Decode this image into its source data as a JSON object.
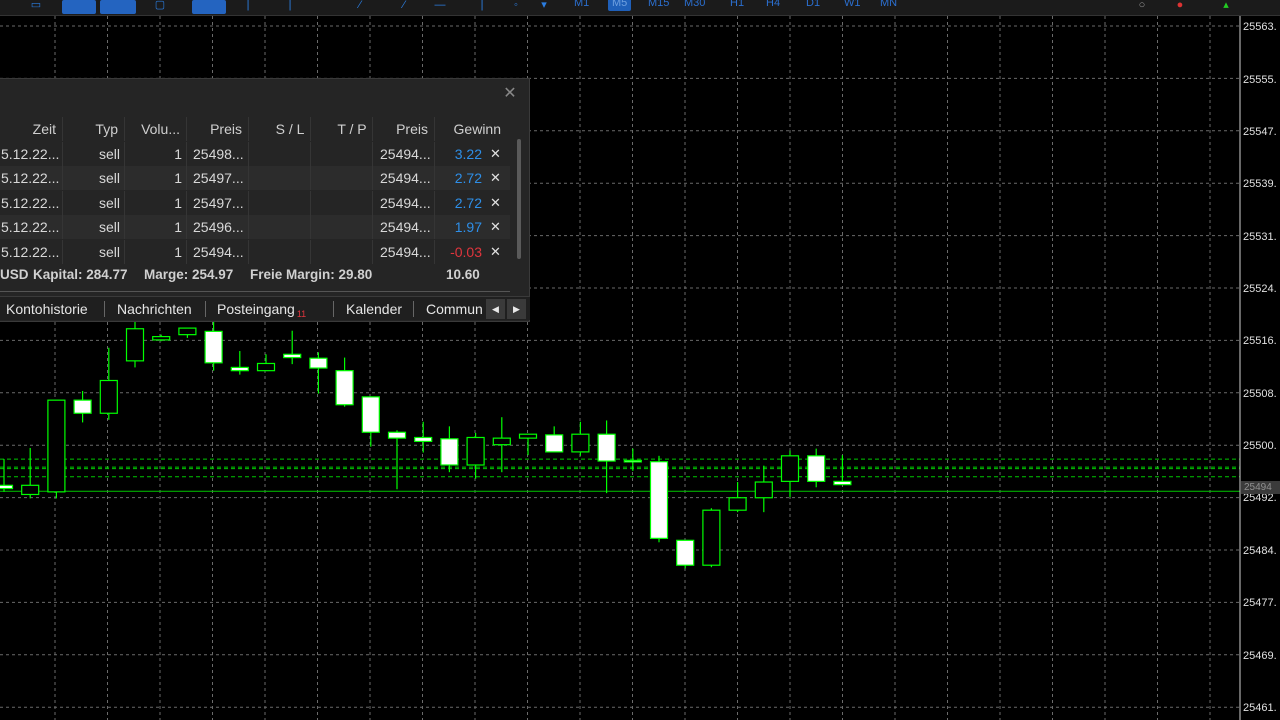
{
  "toolbar": {
    "timeframes": [
      "M1",
      "M5",
      "M15",
      "M30",
      "H1",
      "H4",
      "D1",
      "W1",
      "MN"
    ],
    "active_timeframe": "M5"
  },
  "trade_panel": {
    "columns": [
      "Zeit",
      "Typ",
      "Volu...",
      "Preis",
      "S / L",
      "T / P",
      "Preis",
      "Gewinn"
    ],
    "rows": [
      {
        "time": "5.12.22...",
        "type": "sell",
        "volume": "1",
        "open_price": "25498...",
        "sl": "",
        "tp": "",
        "price": "25494...",
        "profit": "3.22"
      },
      {
        "time": "5.12.22...",
        "type": "sell",
        "volume": "1",
        "open_price": "25497...",
        "sl": "",
        "tp": "",
        "price": "25494...",
        "profit": "2.72"
      },
      {
        "time": "5.12.22...",
        "type": "sell",
        "volume": "1",
        "open_price": "25497...",
        "sl": "",
        "tp": "",
        "price": "25494...",
        "profit": "2.72"
      },
      {
        "time": "5.12.22...",
        "type": "sell",
        "volume": "1",
        "open_price": "25496...",
        "sl": "",
        "tp": "",
        "price": "25494...",
        "profit": "1.97"
      },
      {
        "time": "5.12.22...",
        "type": "sell",
        "volume": "1",
        "open_price": "25494...",
        "sl": "",
        "tp": "",
        "price": "25494...",
        "profit": "-0.03"
      }
    ],
    "summary": {
      "currency": "USD",
      "kapital": "Kapital: 284.77",
      "marge": "Marge: 254.97",
      "freie_margin": "Freie Margin: 29.80",
      "total": "10.60"
    },
    "close_symbol": "✕",
    "row_close_symbol": "✕"
  },
  "tabs": [
    {
      "label": "Kontohistorie"
    },
    {
      "label": "Nachrichten"
    },
    {
      "label": "Posteingang",
      "badge": "11"
    },
    {
      "label": "Kalender"
    },
    {
      "label": "Commun"
    }
  ],
  "tab_nav": {
    "left": "◀",
    "right": "▶"
  },
  "price_axis": {
    "labels": [
      "25563.",
      "25555.",
      "25547.",
      "25539.",
      "25531.",
      "25524.",
      "25516.",
      "25508.",
      "25500.",
      "25492.",
      "25484.",
      "25477.",
      "25469.",
      "25461."
    ],
    "current_price": "25494"
  },
  "chart_data": {
    "type": "candlestick",
    "colors": {
      "bull": "#000000",
      "bear": "#ffffff",
      "outline": "#00ff00",
      "grid": "#6a6a6a",
      "trade_line": "#00c800"
    },
    "ylim": [
      25459,
      25566
    ],
    "trade_levels": [
      25498,
      25497,
      25497,
      25496,
      25494
    ],
    "candles": [
      {
        "o": 25494.0,
        "h": 25498.0,
        "l": 25493.0,
        "c": 25493.5
      },
      {
        "o": 25492.6,
        "h": 25499.7,
        "l": 25492.0,
        "c": 25494.0
      },
      {
        "o": 25493.0,
        "h": 25507.0,
        "l": 25492.0,
        "c": 25507.0
      },
      {
        "o": 25507.0,
        "h": 25508.4,
        "l": 25503.6,
        "c": 25505.0
      },
      {
        "o": 25505.0,
        "h": 25515.0,
        "l": 25504.0,
        "c": 25510.0
      },
      {
        "o": 25513.0,
        "h": 25520.0,
        "l": 25512.0,
        "c": 25517.9
      },
      {
        "o": 25516.2,
        "h": 25517.0,
        "l": 25516.0,
        "c": 25516.7
      },
      {
        "o": 25517.0,
        "h": 25518.0,
        "l": 25516.5,
        "c": 25518.0
      },
      {
        "o": 25517.5,
        "h": 25519.0,
        "l": 25511.5,
        "c": 25512.7
      },
      {
        "o": 25512.0,
        "h": 25514.5,
        "l": 25510.9,
        "c": 25511.5
      },
      {
        "o": 25511.5,
        "h": 25514.0,
        "l": 25511.5,
        "c": 25512.6
      },
      {
        "o": 25514.0,
        "h": 25517.6,
        "l": 25512.5,
        "c": 25513.5
      },
      {
        "o": 25513.4,
        "h": 25514.3,
        "l": 25508.0,
        "c": 25511.9
      },
      {
        "o": 25511.5,
        "h": 25513.5,
        "l": 25506.0,
        "c": 25506.3
      },
      {
        "o": 25507.5,
        "h": 25507.5,
        "l": 25499.9,
        "c": 25502.1
      },
      {
        "o": 25502.1,
        "h": 25502.4,
        "l": 25493.4,
        "c": 25501.2
      },
      {
        "o": 25501.3,
        "h": 25503.7,
        "l": 25499.0,
        "c": 25500.7
      },
      {
        "o": 25501.1,
        "h": 25503.0,
        "l": 25496.0,
        "c": 25497.1
      },
      {
        "o": 25497.1,
        "h": 25502.0,
        "l": 25495.0,
        "c": 25501.3
      },
      {
        "o": 25500.2,
        "h": 25504.4,
        "l": 25496.0,
        "c": 25501.2
      },
      {
        "o": 25501.2,
        "h": 25501.8,
        "l": 25498.6,
        "c": 25501.8
      },
      {
        "o": 25501.7,
        "h": 25503.0,
        "l": 25500.0,
        "c": 25499.1
      },
      {
        "o": 25499.1,
        "h": 25503.7,
        "l": 25498.5,
        "c": 25501.8
      },
      {
        "o": 25501.8,
        "h": 25503.9,
        "l": 25492.8,
        "c": 25497.7
      },
      {
        "o": 25497.8,
        "h": 25499.6,
        "l": 25496.2,
        "c": 25497.6
      },
      {
        "o": 25497.6,
        "h": 25498.5,
        "l": 25485.3,
        "c": 25485.9
      },
      {
        "o": 25485.6,
        "h": 25485.6,
        "l": 25481.3,
        "c": 25481.8
      },
      {
        "o": 25481.8,
        "h": 25490.5,
        "l": 25481.5,
        "c": 25490.2
      },
      {
        "o": 25490.2,
        "h": 25494.5,
        "l": 25489.9,
        "c": 25492.1
      },
      {
        "o": 25492.1,
        "h": 25497.0,
        "l": 25489.9,
        "c": 25494.5
      },
      {
        "o": 25494.6,
        "h": 25499.3,
        "l": 25492.2,
        "c": 25498.5
      },
      {
        "o": 25498.5,
        "h": 25499.6,
        "l": 25493.7,
        "c": 25494.6
      },
      {
        "o": 25494.6,
        "h": 25498.6,
        "l": 25494.0,
        "c": 25494.1
      }
    ]
  }
}
